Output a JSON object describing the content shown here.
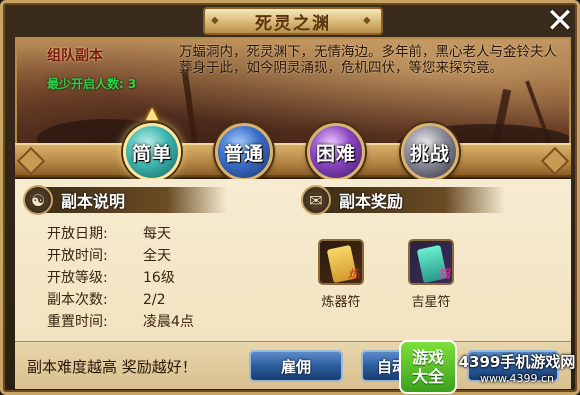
{
  "window": {
    "title": "死灵之渊",
    "close_icon": "close-icon"
  },
  "scene": {
    "dungeon_type": "组队副本",
    "min_players_label": "最少开启人数:",
    "min_players_value": "3",
    "story": "万蝠洞内，死灵渊下，无情海边。多年前，黑心老人与金铃夫人葬身于此，如今阴灵涌现，危机四伏，等您来探究竟。"
  },
  "difficulty": {
    "selected": "easy",
    "options": [
      {
        "key": "easy",
        "label": "简单"
      },
      {
        "key": "normal",
        "label": "普通"
      },
      {
        "key": "hard",
        "label": "困难"
      },
      {
        "key": "challenge",
        "label": "挑战"
      }
    ]
  },
  "description": {
    "title": "副本说明",
    "icon": "yin-yang-icon",
    "rows": [
      {
        "key": "开放日期:",
        "value": "每天"
      },
      {
        "key": "开放时间:",
        "value": "全天"
      },
      {
        "key": "开放等级:",
        "value": "16级"
      },
      {
        "key": "副本次数:",
        "value": "2/2"
      },
      {
        "key": "重置时间:",
        "value": "凌晨4点"
      }
    ]
  },
  "rewards": {
    "title": "副本奖励",
    "icon": "scroll-icon",
    "items": [
      {
        "name": "炼器符",
        "icon": "refine-talisman-icon"
      },
      {
        "name": "吉星符",
        "icon": "lucky-star-talisman-icon"
      }
    ]
  },
  "bottom": {
    "hint": "副本难度越高 奖励越好！",
    "hire_label": "雇佣",
    "auto_label": "自动"
  },
  "watermark": {
    "badge_line1": "游戏",
    "badge_line2": "大全",
    "site_name": "4399手机游戏网",
    "site_url": "www.4399.cn"
  },
  "colors": {
    "frame_gold": "#c8a564",
    "content_bg": "#f7ecd2",
    "min_players_green": "#2fd14a",
    "button_blue": "#2a5a9a"
  }
}
